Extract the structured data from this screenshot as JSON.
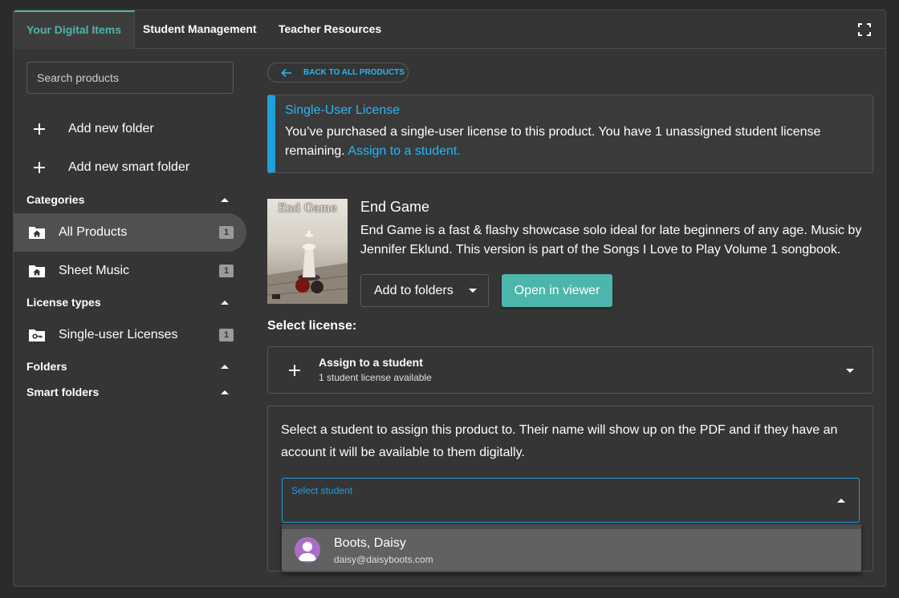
{
  "tabs": [
    {
      "label": "Your Digital Items",
      "active": true
    },
    {
      "label": "Student Management",
      "active": false
    },
    {
      "label": "Teacher Resources",
      "active": false
    }
  ],
  "sidebar": {
    "search_placeholder": "Search products",
    "actions": [
      {
        "label": "Add new folder",
        "icon": "plus-icon"
      },
      {
        "label": "Add new smart folder",
        "icon": "plus-icon"
      }
    ],
    "sections": {
      "categories": "Categories",
      "license_types": "License types",
      "folders": "Folders",
      "smart_folders": "Smart folders"
    },
    "categories": [
      {
        "label": "All Products",
        "count": "1",
        "icon": "home-folder-icon",
        "selected": true
      },
      {
        "label": "Sheet Music",
        "count": "1",
        "icon": "home-folder-icon",
        "selected": false
      }
    ],
    "license_types": [
      {
        "label": "Single-user Licenses",
        "count": "1",
        "icon": "key-folder-icon"
      }
    ]
  },
  "main": {
    "back_label": "BACK TO ALL PRODUCTS",
    "alert": {
      "title": "Single-User License",
      "body": "You’ve purchased a single-user license to this product. You have 1 unassigned student license remaining.",
      "link": "Assign to a student."
    },
    "product": {
      "cover_title": "End Game",
      "title": "End Game",
      "description": "End Game is a fast & flashy showcase solo ideal for late beginners of any age. Music by Jennifer Eklund. This version is part of the Songs I Love to Play Volume 1 songbook.",
      "add_to_folders": "Add to folders",
      "open_viewer": "Open in viewer"
    },
    "select_license": "Select license:",
    "assign": {
      "title": "Assign to a student",
      "subtitle": "1 student license available"
    },
    "detail": {
      "text": "Select a student to assign this product to. Their name will show up on the PDF and if they have an account it will be available to them digitally.",
      "field_label": "Select student",
      "options": [
        {
          "name": "Boots, Daisy",
          "email": "daisy@daisyboots.com"
        }
      ]
    }
  },
  "colors": {
    "accent_teal": "#4db6ac",
    "link_blue": "#29b6f6",
    "alert_bar": "#1ea0dc",
    "avatar": "#ab6ec6"
  }
}
